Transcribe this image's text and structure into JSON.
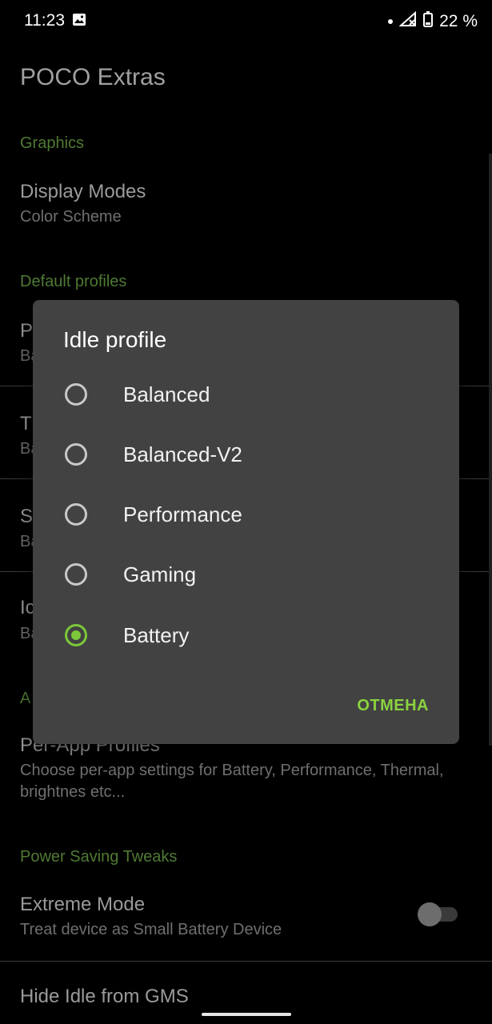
{
  "status_bar": {
    "time": "11:23",
    "battery": "22 %"
  },
  "app": {
    "title": "POCO Extras"
  },
  "settings": {
    "graphics_header": "Graphics",
    "display_modes_title": "Display Modes",
    "display_modes_summary": "Color Scheme",
    "default_profiles_header": "Default profiles",
    "partial_rows": [
      {
        "title": "P",
        "summary": "Ba"
      },
      {
        "title": "T",
        "summary": "Ba"
      },
      {
        "title": "S",
        "summary": "Ba"
      },
      {
        "title": "Ic",
        "summary": "Ba"
      }
    ],
    "partial_header": "A",
    "per_app_title": "Per-App Profiles",
    "per_app_summary": "Choose per-app settings for Battery, Performance, Thermal, brightnes etc...",
    "power_saving_header": "Power Saving Tweaks",
    "extreme_mode_title": "Extreme Mode",
    "extreme_mode_summary": "Treat device as Small Battery Device",
    "hide_idle_title": "Hide Idle from GMS"
  },
  "dialog": {
    "title": "Idle profile",
    "options": [
      {
        "label": "Balanced",
        "checked": false
      },
      {
        "label": "Balanced-V2",
        "checked": false
      },
      {
        "label": "Performance",
        "checked": false
      },
      {
        "label": "Gaming",
        "checked": false
      },
      {
        "label": "Battery",
        "checked": true
      }
    ],
    "cancel_label": "ОТМЕНА"
  }
}
